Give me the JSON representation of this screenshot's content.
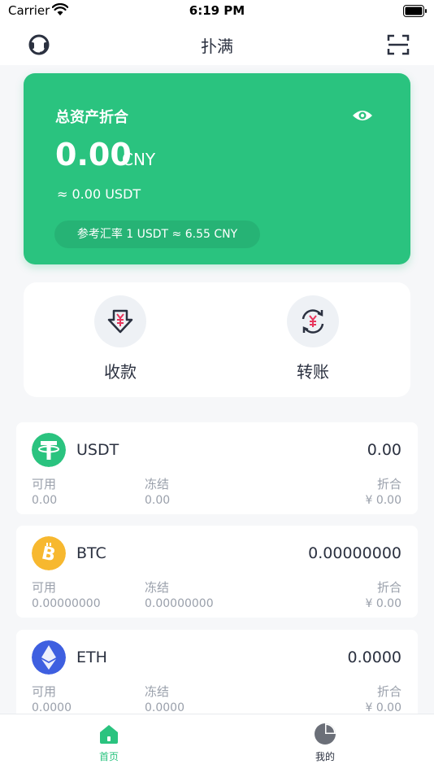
{
  "status_bar": {
    "carrier": "Carrier",
    "time": "6:19 PM"
  },
  "nav": {
    "title": "扑满",
    "left_icon": "support-icon",
    "right_icon": "scan-icon"
  },
  "asset_card": {
    "title": "总资产折合",
    "amount": "0.00",
    "currency": "CNY",
    "usdt_equiv": "≈ 0.00 USDT",
    "rate": "参考汇率 1 USDT ≈ 6.55 CNY",
    "eye_icon": "eye-icon",
    "background": "#2ac37f"
  },
  "actions": [
    {
      "label": "收款",
      "icon": "receive-icon"
    },
    {
      "label": "转账",
      "icon": "transfer-icon"
    }
  ],
  "columns": {
    "available": "可用",
    "frozen": "冻结",
    "converted": "折合"
  },
  "coins": [
    {
      "symbol": "USDT",
      "total": "0.00",
      "available": "0.00",
      "frozen": "0.00",
      "converted": "¥ 0.00",
      "color": "#26a17b"
    },
    {
      "symbol": "BTC",
      "total": "0.00000000",
      "available": "0.00000000",
      "frozen": "0.00000000",
      "converted": "¥ 0.00",
      "color": "#f7b82f"
    },
    {
      "symbol": "ETH",
      "total": "0.0000",
      "available": "0.0000",
      "frozen": "0.0000",
      "converted": "¥ 0.00",
      "color": "#3e5fe0"
    }
  ],
  "tabs": [
    {
      "label": "首页",
      "icon": "home-icon",
      "active": true,
      "color": "#2ac37f"
    },
    {
      "label": "我的",
      "icon": "pie-chart-icon",
      "active": false,
      "color": "#2b3140"
    }
  ]
}
